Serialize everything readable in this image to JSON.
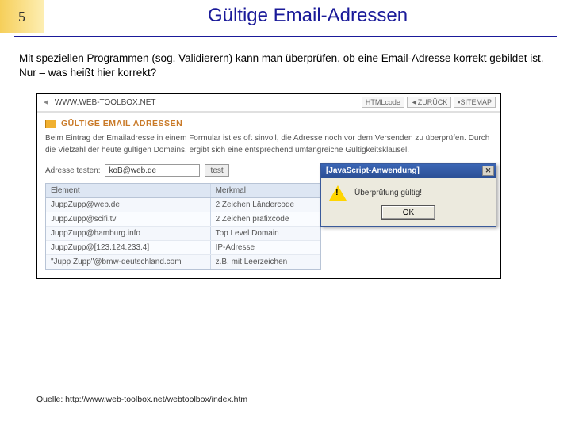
{
  "slide": {
    "number": "5",
    "title": "Gültige Email-Adressen",
    "body": "Mit speziellen Programmen (sog. Validierern) kann man überprüfen, ob eine Email-Adresse korrekt gebildet ist. Nur – was heißt hier korrekt?",
    "source": "Quelle: http://www.web-toolbox.net/webtoolbox/index.htm"
  },
  "screenshot": {
    "url_arrow": "◄",
    "url": "WWW.WEB-TOOLBOX.NET",
    "nav": {
      "a": "HTMLcode",
      "b": "◄ZURÜCK",
      "c": "▪SITEMAP"
    },
    "heading": "GÜLTIGE EMAIL ADRESSEN",
    "paragraph": "Beim Eintrag der Emailadresse in einem Formular ist es oft sinvoll, die Adresse noch vor dem Versenden zu überprüfen. Durch die Vielzahl der heute gültigen Domains, ergibt sich eine entsprechend umfangreiche Gültigkeitsklausel.",
    "test_label": "Adresse testen:",
    "test_value": "koB@web.de",
    "test_button": "test",
    "table": {
      "head1": "Element",
      "head2": "Merkmal",
      "rows": [
        {
          "a": "JuppZupp@web.de",
          "b": "2 Zeichen Ländercode"
        },
        {
          "a": "JuppZupp@scifi.tv",
          "b": "2 Zeichen präfixcode"
        },
        {
          "a": "JuppZupp@hamburg.info",
          "b": "Top Level Domain"
        },
        {
          "a": "JuppZupp@[123.124.233.4]",
          "b": "IP-Adresse"
        },
        {
          "a": "\"Jupp Zupp\"@bmw-deutschland.com",
          "b": "z.B. mit Leerzeichen"
        }
      ]
    }
  },
  "dialog": {
    "title": "[JavaScript-Anwendung]",
    "message": "Überprüfung gültig!",
    "ok": "OK",
    "close": "✕"
  }
}
